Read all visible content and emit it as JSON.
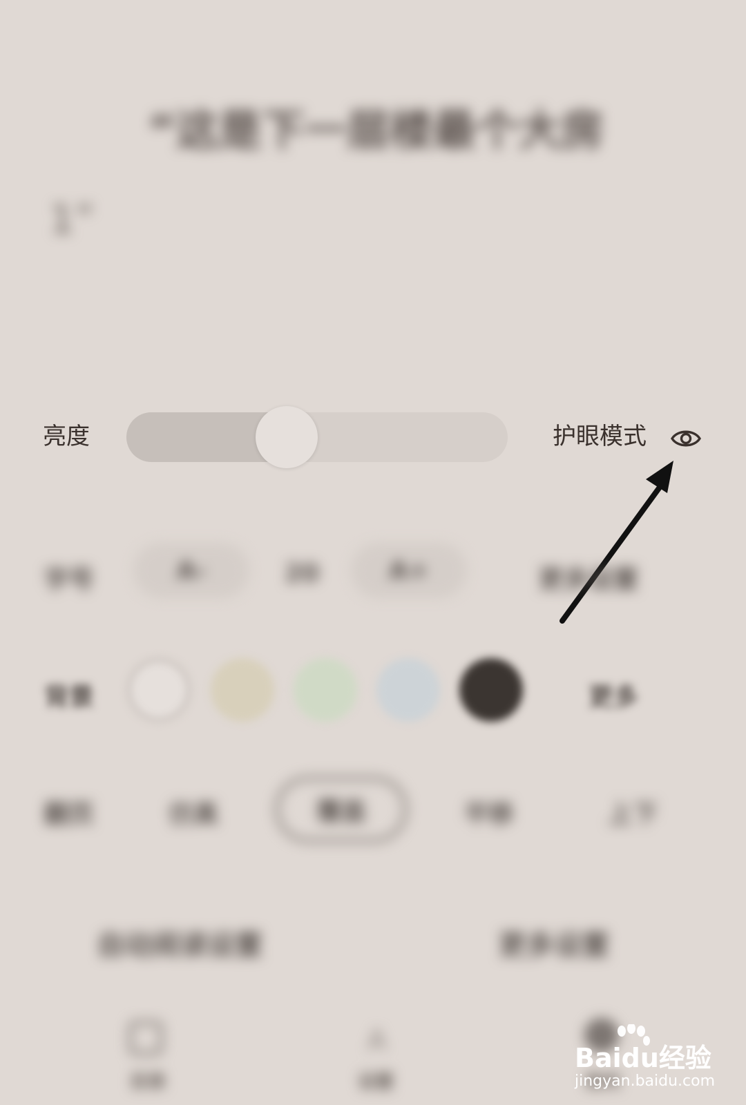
{
  "reader": {
    "line1": "“这是下一层楼最个大房",
    "line2": "1”"
  },
  "brightness": {
    "label": "亮度",
    "level": 0.42
  },
  "eye_mode": {
    "label": "护眼模式",
    "icon": "eye-icon"
  },
  "font_row": {
    "label": "字号",
    "decrease": "A-",
    "value": "20",
    "increase": "A+",
    "more": "更多设置"
  },
  "background_row": {
    "label": "背景",
    "swatches": [
      "#f1ece8",
      "#dcd5c0",
      "#d2dcc8",
      "#cfd5d9",
      "#3b3531"
    ],
    "more": "更多"
  },
  "flip_row": {
    "label": "翻页",
    "options": [
      "仿真",
      "覆盖",
      "平移",
      "上下"
    ],
    "selected": "覆盖"
  },
  "bottom_links": {
    "left": "自动阅读设置",
    "right": "更多设置"
  },
  "bottom_nav": [
    {
      "label": "目录",
      "icon": "list-icon"
    },
    {
      "label": "设置",
      "icon": "font-icon"
    },
    {
      "label": "夜间",
      "icon": "moon-icon"
    }
  ],
  "watermark": {
    "brand": "Baidu经验",
    "url": "jingyan.baidu.com"
  },
  "colors": {
    "background": "#e0d9d4",
    "text": "#3a312d",
    "arrow": "#111111"
  }
}
